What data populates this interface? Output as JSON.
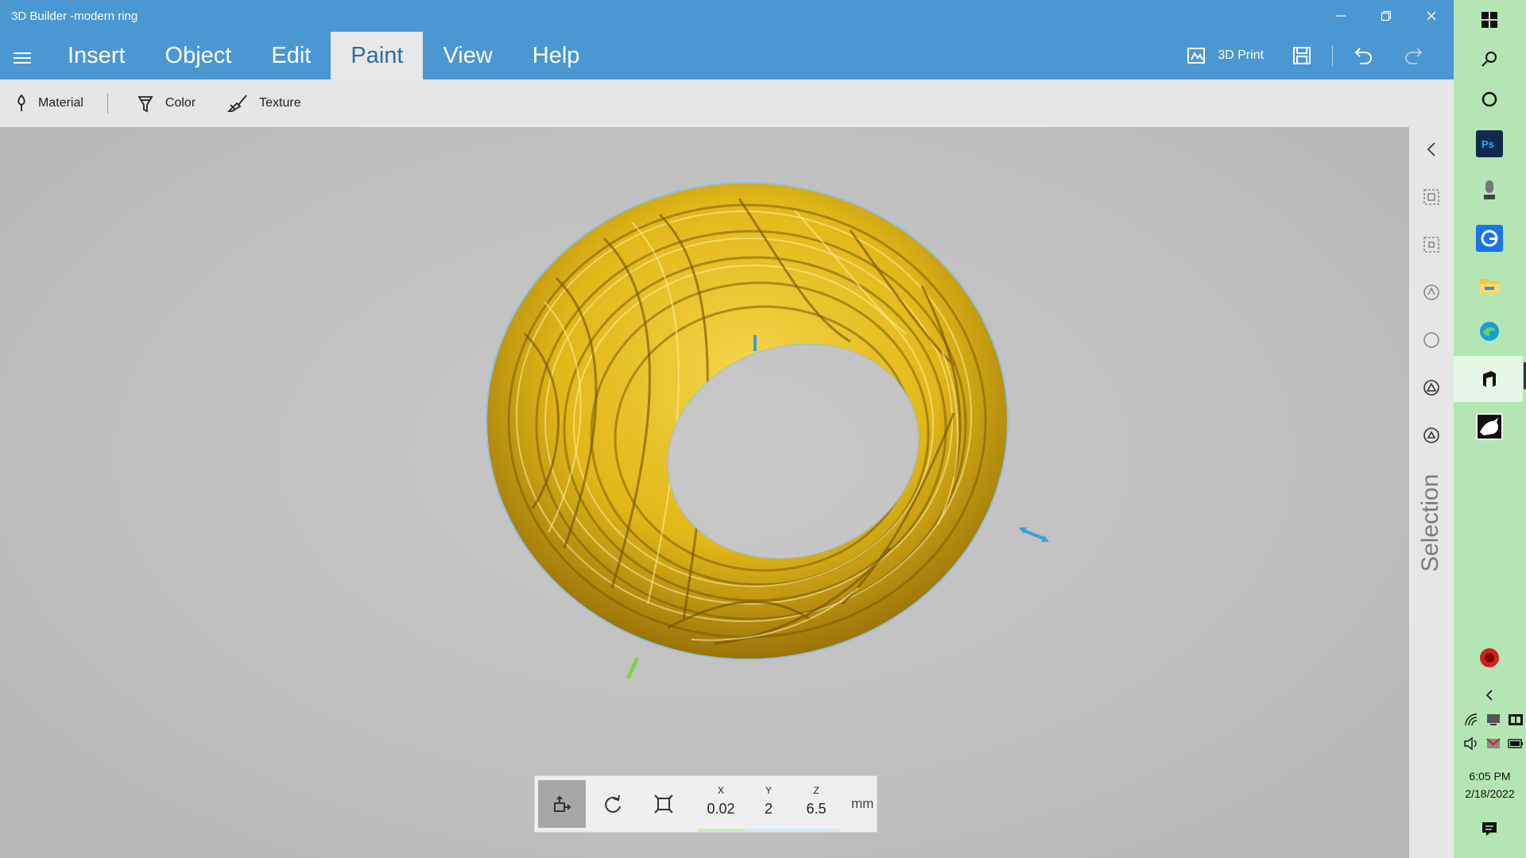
{
  "window": {
    "title": "3D Builder -modern ring",
    "controls": [
      "minimize-icon",
      "restore-icon",
      "close-icon"
    ]
  },
  "menu": {
    "tabs": [
      {
        "label": "Insert",
        "active": false
      },
      {
        "label": "Object",
        "active": false
      },
      {
        "label": "Edit",
        "active": false
      },
      {
        "label": "Paint",
        "active": true
      },
      {
        "label": "View",
        "active": false
      },
      {
        "label": "Help",
        "active": false
      }
    ],
    "print_label": "3D Print"
  },
  "toolbar": {
    "material_label": "Material",
    "color_label": "Color",
    "texture_label": "Texture"
  },
  "transform": {
    "x_label": "X",
    "x_value": "0.02",
    "y_label": "Y",
    "y_value": "2",
    "z_label": "Z",
    "z_value": "6.5",
    "unit": "mm"
  },
  "side_panel": {
    "label": "Selection"
  },
  "taskbar": {
    "time": "6:05 PM",
    "date": "2/18/2022"
  },
  "colors": {
    "header": "#4b97d2",
    "taskbar": "#b4e6b4",
    "ring_gold": "#e2b818",
    "x_axis": "#7fd24a",
    "y_axis": "#8ec8e8",
    "z_axis": "#3aa0d8"
  }
}
